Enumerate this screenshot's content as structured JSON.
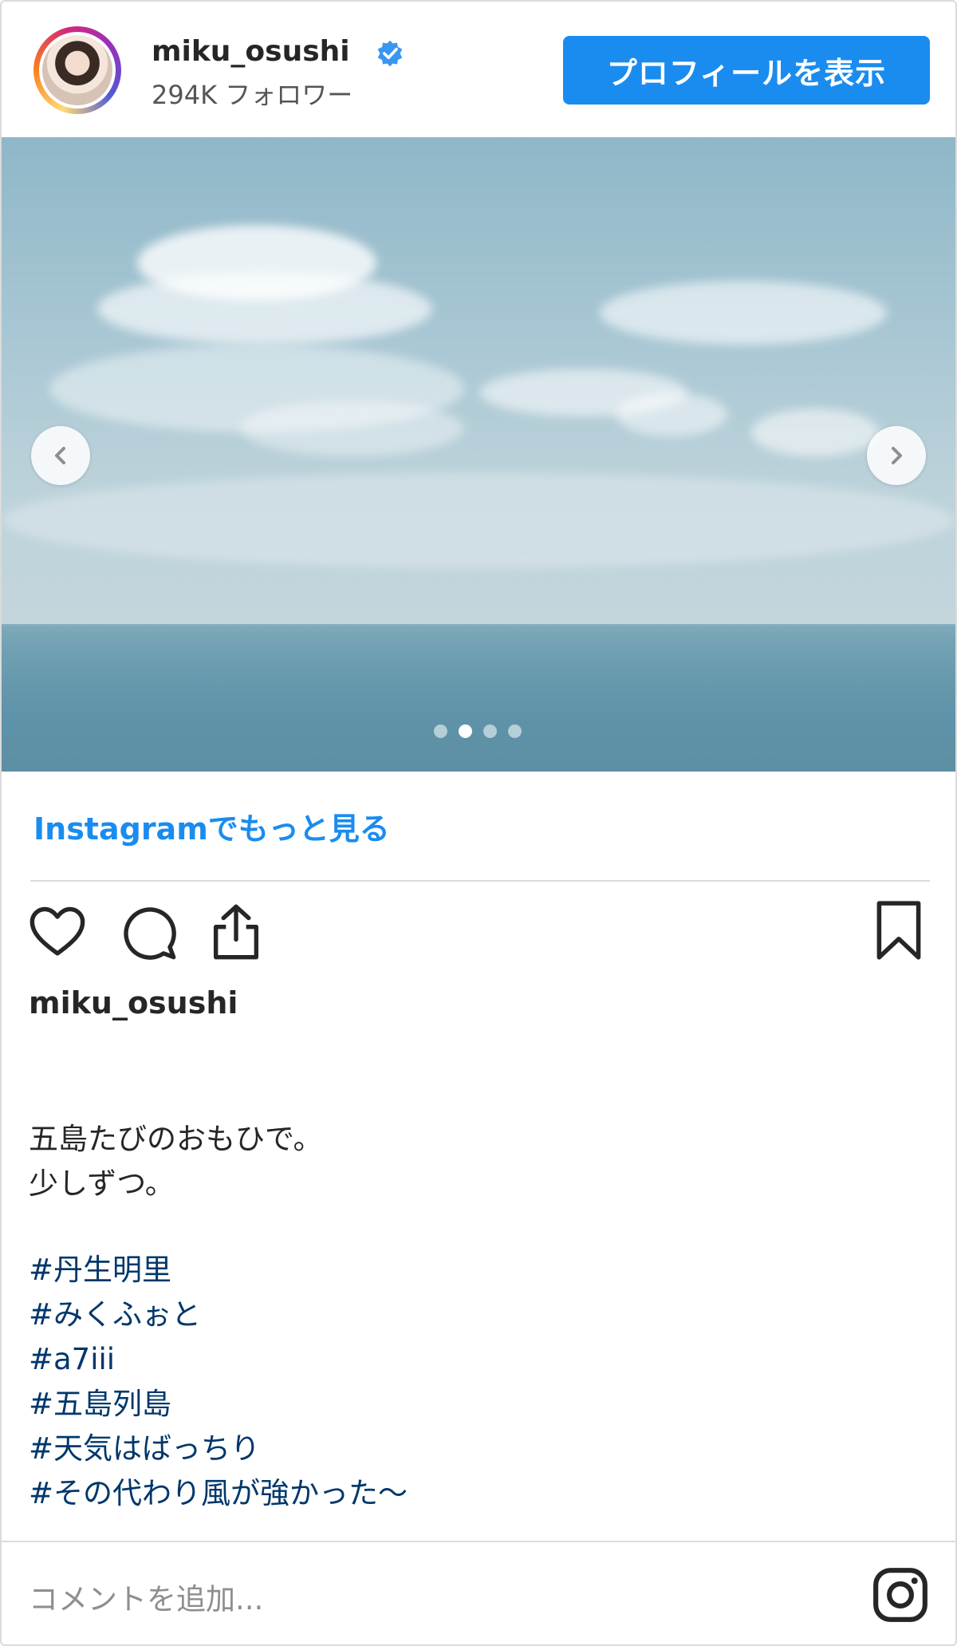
{
  "header": {
    "username": "miku_osushi",
    "followers": "294K フォロワー",
    "profile_button": "プロフィールを表示",
    "verified_icon": "verified-badge-icon"
  },
  "photo": {
    "carousel_total": 4,
    "carousel_active_index": 1,
    "prev_icon": "chevron-left-icon",
    "next_icon": "chevron-right-icon"
  },
  "more_link": "Instagramでもっと見る",
  "actions": {
    "like_icon": "heart-icon",
    "comment_icon": "comment-bubble-icon",
    "share_icon": "share-icon",
    "save_icon": "bookmark-icon"
  },
  "caption": {
    "username": "miku_osushi",
    "lines": [
      "五島たびのおもひで。",
      "少しずつ。"
    ],
    "hashtags": [
      "#丹生明里",
      "#みくふぉと",
      "#a7iii",
      "#五島列島",
      "#天気はばっちり",
      "#その代わり風が強かった〜"
    ]
  },
  "comment_placeholder": "コメントを追加...",
  "brand_icon": "instagram-icon",
  "colors": {
    "accent": "#1a8cf0",
    "hashtag": "#00376b",
    "border": "#dbdbdb"
  }
}
